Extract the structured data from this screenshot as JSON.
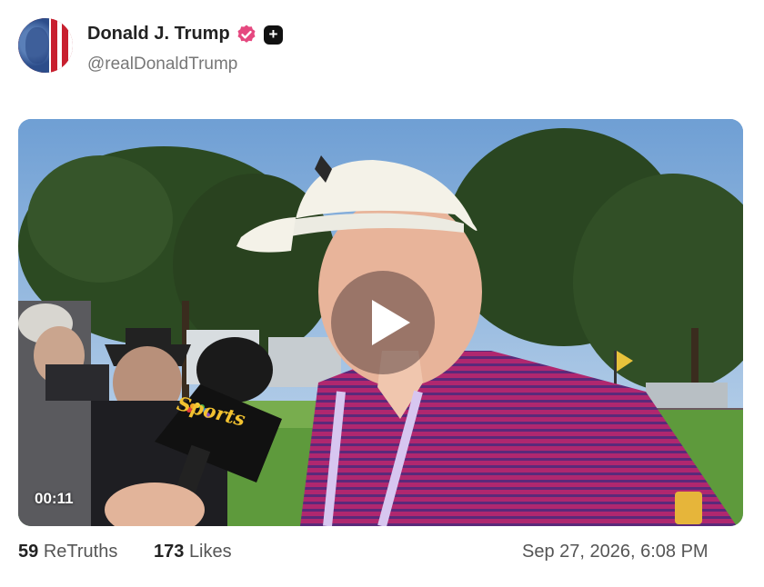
{
  "author": {
    "display_name": "Donald J. Trump",
    "handle": "@realDonaldTrump",
    "verified_icon": "verified-badge-icon",
    "plus_icon": "plus-badge-icon",
    "verified_color": "#e5487f"
  },
  "media": {
    "type": "video",
    "timestamp": "00:11",
    "play_icon": "play-icon",
    "mic_brand": "Sports"
  },
  "stats": {
    "retruths_count": "59",
    "retruths_label": "ReTruths",
    "likes_count": "173",
    "likes_label": "Likes"
  },
  "posted_at": "Sep 27, 2026, 6:08 PM"
}
